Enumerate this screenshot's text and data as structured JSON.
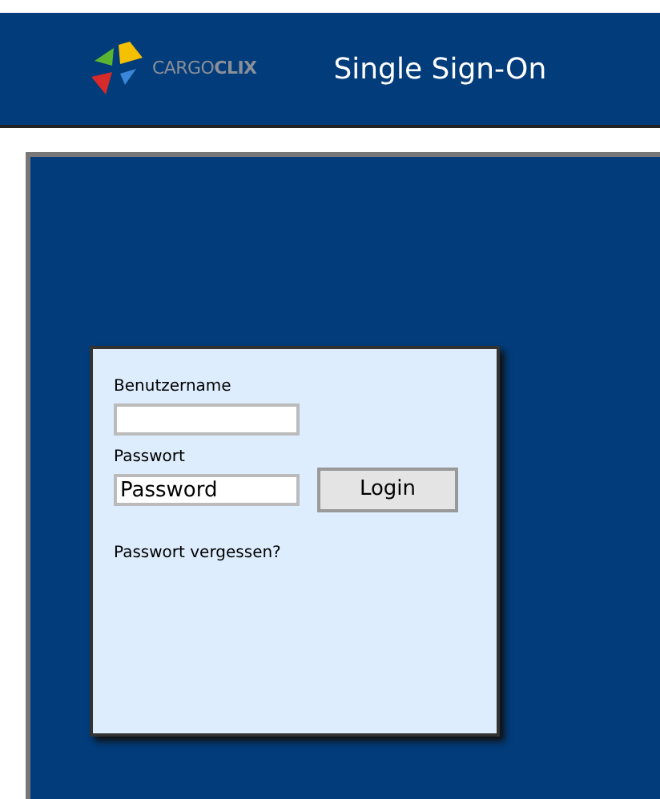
{
  "header": {
    "brand": "CARGO**CLIX**",
    "title": "Single Sign-On"
  },
  "login": {
    "username_label": "Benutzername",
    "password_label": "Passwort",
    "password_value": "Password",
    "button": "Login",
    "forgot_link": "Passwort vergessen?"
  }
}
